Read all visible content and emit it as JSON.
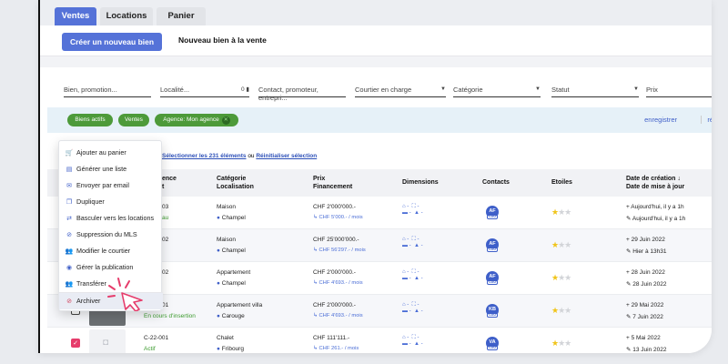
{
  "tabs": [
    {
      "label": "Ventes",
      "active": true
    },
    {
      "label": "Locations",
      "active": false
    },
    {
      "label": "Panier",
      "active": false
    }
  ],
  "actionbar": {
    "create_button": "Créer un nouveau bien",
    "subtitle": "Nouveau bien à la vente"
  },
  "filters": {
    "search_placeholder": "Bien, promotion...",
    "location_placeholder": "Localité...",
    "location_badge": "0",
    "contact_placeholder": "Contact, promoteur, entrepri...",
    "broker_label": "Courtier en charge",
    "category_label": "Catégorie",
    "status_label": "Statut",
    "price_label": "Prix"
  },
  "chips": {
    "active": "Biens actifs",
    "sales": "Ventes",
    "agency": "Agence: Mon agence",
    "save_link": "enregistrer",
    "reset_link": "ré"
  },
  "selection": {
    "select_all": "Sélectionner les 231 éléments",
    "or": "ou",
    "reset": "Réinitialiser sélection"
  },
  "table": {
    "headers": {
      "reference": "ence",
      "reference2": "t",
      "category": "Catégorie",
      "location": "Localisation",
      "price": "Prix",
      "financing": "Financement",
      "dimensions": "Dimensions",
      "contacts": "Contacts",
      "stars": "Etoiles",
      "created": "Date de création ↓",
      "updated": "Date de mise à jour"
    },
    "rows": [
      {
        "ref": "03",
        "status": "au",
        "category": "Maison",
        "location": "Champel",
        "price": "CHF 2'000'000.-",
        "financing": "↳ CHF 5'000.- / mois",
        "avatar": "AF",
        "stars": 1,
        "created": "+ Aujourd'hui, il y a 1h",
        "updated": "✎ Aujourd'hui, il y a 1h"
      },
      {
        "ref": "02",
        "status": "",
        "category": "Maison",
        "location": "Champel",
        "price": "CHF 25'000'000.-",
        "financing": "↳ CHF 56'297.- / mois",
        "avatar": "AF",
        "stars": 1,
        "created": "+ 29 Juin 2022",
        "updated": "✎ Hier à 13h31"
      },
      {
        "ref": "02",
        "status": "",
        "category": "Appartement",
        "location": "Champel",
        "price": "CHF 2'000'000.-",
        "financing": "↳ CHF 4'693.- / mois",
        "avatar": "AF",
        "stars": 1,
        "created": "+ 28 Juin 2022",
        "updated": "✎ 28 Juin 2022"
      },
      {
        "ref": "01",
        "status": "En cours d'insertion",
        "category": "Appartement villa",
        "location": "Carouge",
        "price": "CHF 2'000'000.-",
        "financing": "↳ CHF 4'693.- / mois",
        "avatar": "KB",
        "stars": 1,
        "created": "+ 29 Mai 2022",
        "updated": "✎ 7 Juin 2022"
      },
      {
        "ref": "C-22-001",
        "status": "Actif",
        "category": "Chalet",
        "location": "Fribourg",
        "price": "CHF 111'111.-",
        "financing": "↳ CHF 261.- / mois",
        "avatar": "VA",
        "stars": 1,
        "created": "+ 5 Mai 2022",
        "updated": "✎ 13 Juin 2022"
      }
    ],
    "avatar_sub": "CGU"
  },
  "menu": {
    "items": [
      {
        "icon": "cart-icon",
        "glyph": "🛒",
        "label": "Ajouter au panier"
      },
      {
        "icon": "list-icon",
        "glyph": "▤",
        "label": "Générer une liste"
      },
      {
        "icon": "email-icon",
        "glyph": "✉",
        "label": "Envoyer par email"
      },
      {
        "icon": "copy-icon",
        "glyph": "❐",
        "label": "Dupliquer"
      },
      {
        "icon": "switch-icon",
        "glyph": "⇄",
        "label": "Basculer vers les locations"
      },
      {
        "icon": "eye-off-icon",
        "glyph": "⊘",
        "label": "Suppression du MLS"
      },
      {
        "icon": "users-icon",
        "glyph": "👥",
        "label": "Modifier le courtier"
      },
      {
        "icon": "rss-icon",
        "glyph": "◉",
        "label": "Gérer la publication"
      },
      {
        "icon": "transfer-icon",
        "glyph": "👥",
        "label": "Transférer"
      },
      {
        "icon": "archive-icon",
        "glyph": "⊘",
        "label": "Archiver"
      }
    ]
  },
  "colors": {
    "brand": "#5572d8",
    "chip_green": "#4d9a3a",
    "checkbox_pink": "#e63c6b",
    "star": "#f0c419"
  }
}
